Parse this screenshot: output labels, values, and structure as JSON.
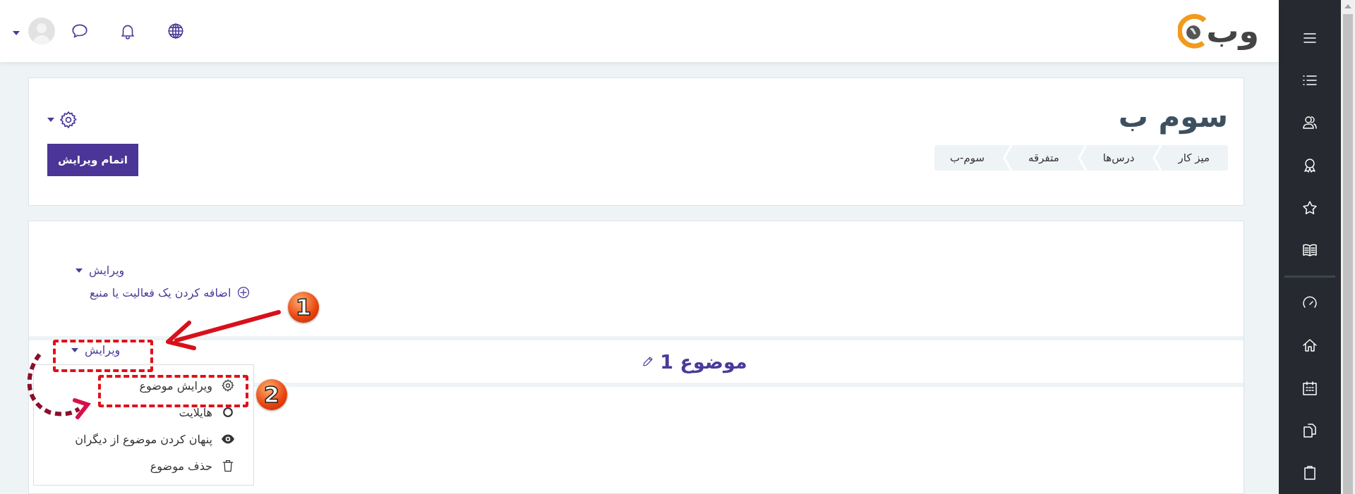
{
  "logo": {
    "text": "وب"
  },
  "header": {
    "title": "سوم ب",
    "breadcrumb": [
      "میز کار",
      "درس‌ها",
      "متفرقه",
      "سوم-ب"
    ],
    "edit_button": "اتمام ویرایش"
  },
  "general_section": {
    "edit_menu": "ویرایش",
    "add_activity": "اضافه کردن یک فعالیت یا منبع"
  },
  "section": {
    "title": "موضوع 1",
    "edit_menu": "ویرایش",
    "menu_items": [
      {
        "label": "ویرایش موضوع",
        "kind": "edit"
      },
      {
        "label": "هایلایت",
        "kind": "highlight"
      },
      {
        "label": "پنهان کردن موضوع از دیگران",
        "kind": "hide"
      },
      {
        "label": "حذف موضوع",
        "kind": "delete"
      }
    ]
  },
  "annotations": [
    {
      "label": "1"
    },
    {
      "label": "2"
    }
  ]
}
